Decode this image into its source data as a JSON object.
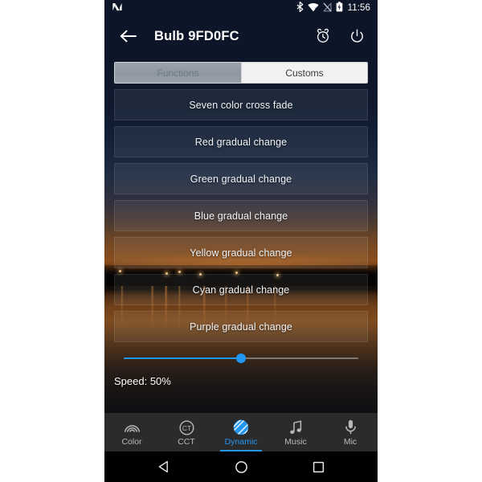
{
  "status_bar": {
    "notification_icon": "android-n-logo-icon",
    "icons": [
      "bluetooth-icon",
      "wifi-icon",
      "signal-off-icon",
      "battery-icon"
    ],
    "clock": "11:56"
  },
  "app_bar": {
    "back_icon": "back-arrow-icon",
    "title": "Bulb 9FD0FC",
    "actions": [
      {
        "name": "alarm-icon",
        "label": "Alarm"
      },
      {
        "name": "power-icon",
        "label": "Power"
      }
    ]
  },
  "tabs": {
    "items": [
      {
        "label": "Functions",
        "selected": true
      },
      {
        "label": "Customs",
        "selected": false
      }
    ]
  },
  "effects": {
    "items": [
      {
        "label": "Seven color cross fade"
      },
      {
        "label": "Red gradual change"
      },
      {
        "label": "Green gradual change"
      },
      {
        "label": "Blue gradual change"
      },
      {
        "label": "Yellow gradual change"
      },
      {
        "label": "Cyan gradual change"
      },
      {
        "label": "Purple gradual change"
      }
    ]
  },
  "slider": {
    "value": 50,
    "min": 0,
    "max": 100,
    "fill_color": "#2196f3",
    "track_color": "#e1e6ee"
  },
  "speed": {
    "text": "Speed: 50%"
  },
  "bottom_nav": {
    "active_color": "#2196f3",
    "items": [
      {
        "label": "Color",
        "icon": "rainbow-icon",
        "active": false
      },
      {
        "label": "CCT",
        "icon": "color-temperature-icon",
        "active": false
      },
      {
        "label": "Dynamic",
        "icon": "dynamic-striped-circle-icon",
        "active": true
      },
      {
        "label": "Music",
        "icon": "music-note-icon",
        "active": false
      },
      {
        "label": "Mic",
        "icon": "microphone-icon",
        "active": false
      }
    ]
  },
  "system_nav": {
    "items": [
      {
        "name": "android-back-icon",
        "label": "Back"
      },
      {
        "name": "android-home-icon",
        "label": "Home"
      },
      {
        "name": "android-recents-icon",
        "label": "Recents"
      }
    ]
  },
  "theme": {
    "app_bar_bg": "#0d1628",
    "accent": "#2196f3",
    "bottom_nav_bg": "#2b2b2b",
    "system_nav_bg": "#000000"
  }
}
